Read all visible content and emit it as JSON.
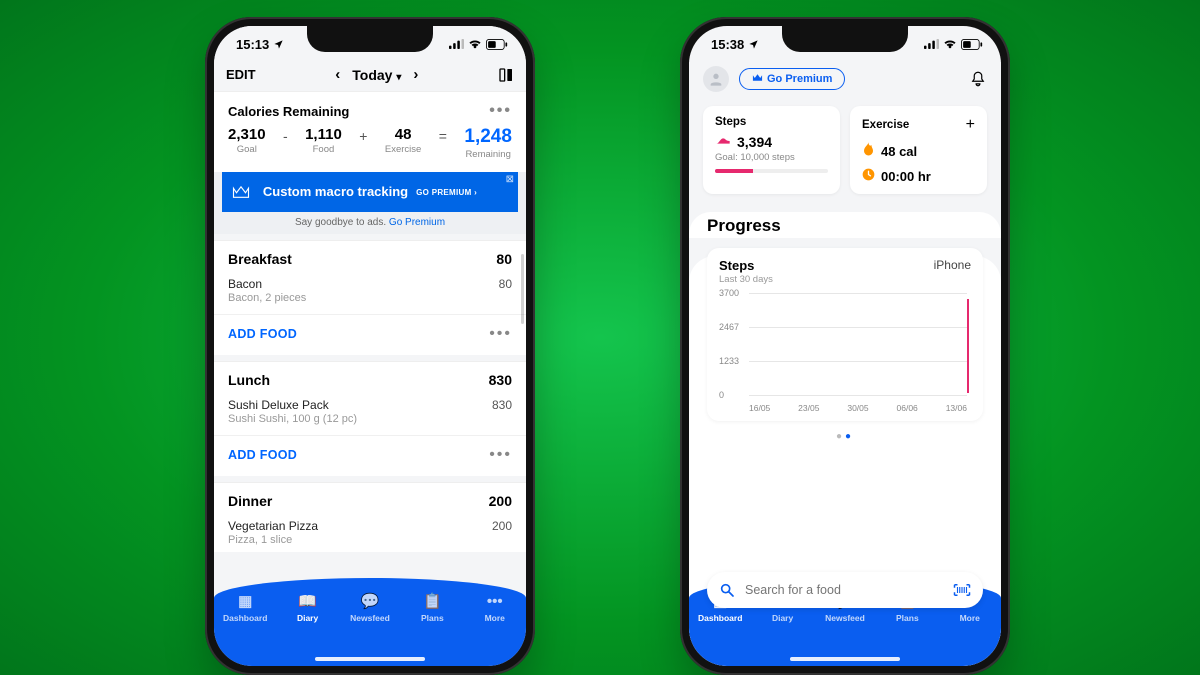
{
  "left": {
    "status": {
      "time": "15:13"
    },
    "toolbar": {
      "edit": "EDIT",
      "day": "Today"
    },
    "calories": {
      "title": "Calories Remaining",
      "goal": {
        "value": "2,310",
        "label": "Goal"
      },
      "food": {
        "value": "1,110",
        "label": "Food"
      },
      "exercise": {
        "value": "48",
        "label": "Exercise"
      },
      "remaining": {
        "value": "1,248",
        "label": "Remaining"
      }
    },
    "ad": {
      "headline": "Custom macro tracking",
      "cta": "GO PREMIUM ›",
      "subtext": "Say goodbye to ads.",
      "sublink": "Go Premium"
    },
    "meals": [
      {
        "name": "Breakfast",
        "total": "80",
        "items": [
          {
            "name": "Bacon",
            "desc": "Bacon, 2 pieces",
            "cal": "80"
          }
        ]
      },
      {
        "name": "Lunch",
        "total": "830",
        "items": [
          {
            "name": "Sushi Deluxe Pack",
            "desc": "Sushi Sushi, 100 g (12 pc)",
            "cal": "830"
          }
        ]
      },
      {
        "name": "Dinner",
        "total": "200",
        "items": [
          {
            "name": "Vegetarian Pizza",
            "desc": "Pizza, 1 slice",
            "cal": "200"
          }
        ]
      }
    ],
    "add_food": "ADD FOOD",
    "tabs": [
      "Dashboard",
      "Diary",
      "Newsfeed",
      "Plans",
      "More"
    ]
  },
  "right": {
    "status": {
      "time": "15:38"
    },
    "go_premium": "Go Premium",
    "steps_card": {
      "title": "Steps",
      "value": "3,394",
      "goal": "Goal: 10,000 steps",
      "pct": 34
    },
    "exercise_card": {
      "title": "Exercise",
      "cal": "48 cal",
      "time": "00:00 hr"
    },
    "progress_title": "Progress",
    "search_placeholder": "Search for a food",
    "tabs": [
      "Dashboard",
      "Diary",
      "Newsfeed",
      "Plans",
      "More"
    ]
  },
  "chart_data": {
    "type": "bar",
    "title": "Steps",
    "subtitle": "Last 30 days",
    "source_label": "iPhone",
    "xlabel": "",
    "ylabel": "",
    "ylim": [
      0,
      3700
    ],
    "y_ticks": [
      0,
      1233,
      2467,
      3700
    ],
    "categories": [
      "16/05",
      "23/05",
      "30/05",
      "06/06",
      "13/06"
    ],
    "values": [
      0,
      0,
      0,
      0,
      3394
    ]
  }
}
